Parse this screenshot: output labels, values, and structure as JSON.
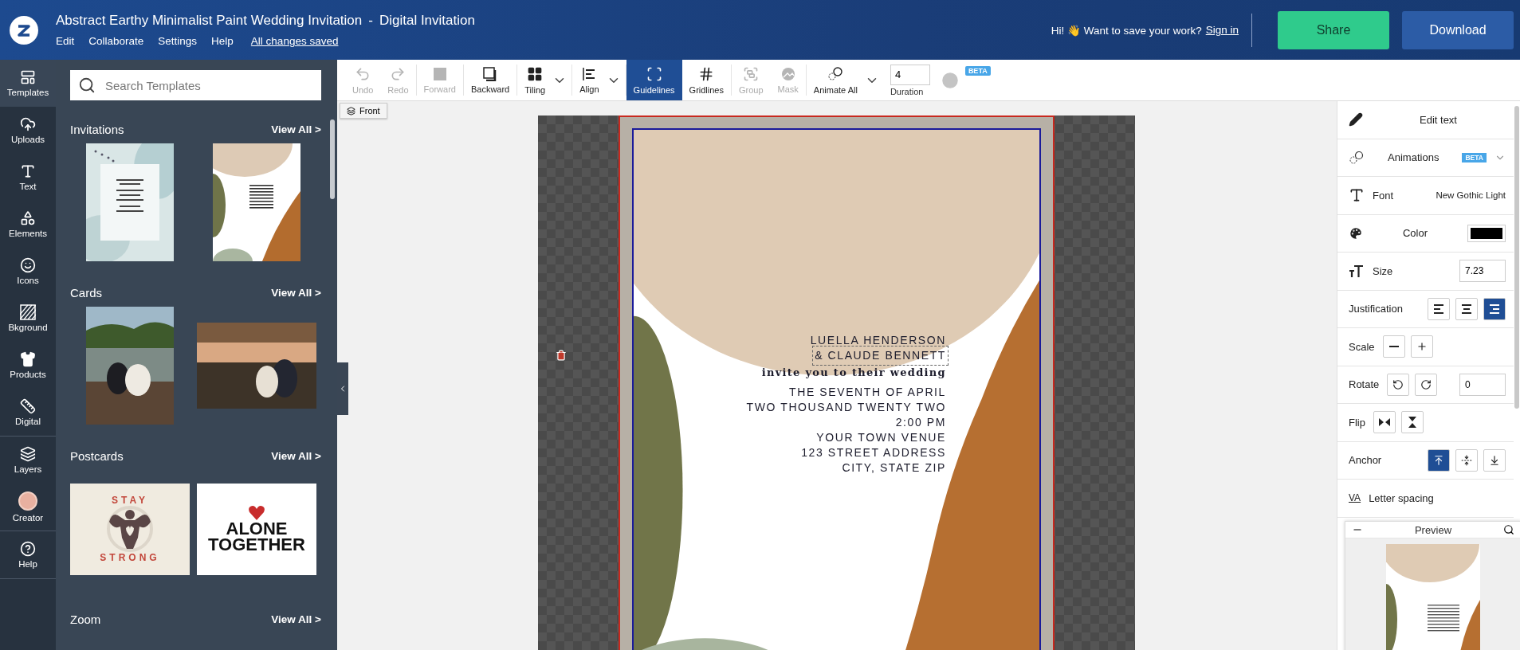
{
  "header": {
    "title": "Abstract Earthy Minimalist Paint Wedding Invitation",
    "separator": "-",
    "subtitle": "Digital Invitation",
    "menu": [
      "Edit",
      "Collaborate",
      "Settings",
      "Help"
    ],
    "save_status": "All changes saved",
    "greeting": "Hi! 👋 Want to save your work?",
    "sign_in": "Sign in",
    "buttons": [
      {
        "label": "Share",
        "kind": "share"
      },
      {
        "label": "Download",
        "kind": "download"
      }
    ]
  },
  "rail_groups": [
    [
      {
        "label": "Templates",
        "kind": "templates",
        "selected": true
      },
      {
        "label": "Uploads",
        "kind": "uploads",
        "selected": false
      },
      {
        "label": "Text",
        "kind": "text",
        "selected": false
      },
      {
        "label": "Elements",
        "kind": "elements",
        "selected": false
      },
      {
        "label": "Icons",
        "kind": "icons",
        "selected": false
      },
      {
        "label": "Bkground",
        "kind": "background",
        "selected": false
      },
      {
        "label": "Products",
        "kind": "products",
        "selected": false
      },
      {
        "label": "Digital",
        "kind": "digital",
        "selected": false
      }
    ],
    [
      {
        "label": "Layers",
        "kind": "layers",
        "selected": false
      },
      {
        "label": "Creator",
        "kind": "creator",
        "selected": false
      }
    ],
    [
      {
        "label": "Help",
        "kind": "help",
        "selected": false
      }
    ]
  ],
  "panel": {
    "search_placeholder": "Search Templates",
    "sections": [
      {
        "title": "Invitations",
        "view_all": "View All >",
        "items": [
          {
            "kind": "watercolor"
          },
          {
            "kind": "earthy"
          }
        ]
      },
      {
        "title": "Cards",
        "view_all": "View All >",
        "items": [
          {
            "kind": "portrait-picture"
          },
          {
            "kind": "landscape-picture"
          }
        ]
      },
      {
        "title": "Postcards",
        "view_all": "View All >",
        "items": [
          {
            "kind": "stay-strong",
            "lines": [
              "STAY",
              "STRONG"
            ]
          },
          {
            "kind": "alone-together",
            "lines": [
              "ALONE",
              "TOGETHER"
            ]
          }
        ]
      },
      {
        "title": "Zoom",
        "view_all": "View All >"
      }
    ]
  },
  "toolbar": {
    "tools": [
      {
        "label": "Undo",
        "kind": "undo",
        "disabled": true,
        "active": false,
        "dropdown": false
      },
      {
        "label": "Redo",
        "kind": "redo",
        "disabled": true,
        "active": false,
        "dropdown": false
      },
      {
        "label": "Forward",
        "kind": "forward",
        "disabled": true,
        "active": false,
        "dropdown": false
      },
      {
        "label": "Backward",
        "kind": "backward",
        "disabled": false,
        "active": false,
        "dropdown": false
      },
      {
        "label": "Tiling",
        "kind": "tiling",
        "disabled": false,
        "active": false,
        "dropdown": true
      },
      {
        "label": "Align",
        "kind": "align",
        "disabled": false,
        "active": false,
        "dropdown": true
      },
      {
        "label": "Guidelines",
        "kind": "guidelines",
        "disabled": false,
        "active": true,
        "dropdown": false
      },
      {
        "label": "Gridlines",
        "kind": "gridlines",
        "disabled": false,
        "active": false,
        "dropdown": false
      },
      {
        "label": "Group",
        "kind": "group",
        "disabled": true,
        "active": false,
        "dropdown": false
      },
      {
        "label": "Mask",
        "kind": "mask",
        "disabled": true,
        "active": false,
        "dropdown": false
      },
      {
        "label": "Animate All",
        "kind": "animate",
        "disabled": false,
        "active": false,
        "dropdown": true
      }
    ],
    "duration": {
      "value": "4",
      "label": "Duration"
    },
    "play_disabled": true,
    "badge": "BETA"
  },
  "layer_button": "Front",
  "design": {
    "lines": [
      {
        "text": "LUELLA HENDERSON",
        "kind": "sans",
        "selected": false
      },
      {
        "text": "& CLAUDE BENNETT",
        "kind": "sans",
        "selected": true
      },
      {
        "text": "invite you to their wedding",
        "kind": "serif",
        "selected": false
      },
      {
        "text": "THE SEVENTH OF APRIL",
        "kind": "sans",
        "selected": false
      },
      {
        "text": "TWO THOUSAND TWENTY TWO",
        "kind": "sans",
        "selected": false
      },
      {
        "text": "2:00 PM",
        "kind": "sans",
        "selected": false
      },
      {
        "text": "YOUR TOWN VENUE",
        "kind": "sans",
        "selected": false
      },
      {
        "text": "123 STREET ADDRESS",
        "kind": "sans",
        "selected": false
      },
      {
        "text": "CITY, STATE ZIP",
        "kind": "sans",
        "selected": false
      }
    ]
  },
  "properties": [
    {
      "kind": "edit",
      "label": "Edit text"
    },
    {
      "kind": "animations",
      "label": "Animations",
      "badge": "BETA"
    },
    {
      "kind": "font",
      "label": "Font",
      "value": "New Gothic Light"
    },
    {
      "kind": "color",
      "label": "Color",
      "color": "#000000"
    },
    {
      "kind": "size",
      "label": "Size",
      "value": "7.23"
    },
    {
      "kind": "justification",
      "label": "Justification",
      "options": [
        {
          "selected": false
        },
        {
          "selected": false
        },
        {
          "selected": true
        }
      ]
    },
    {
      "kind": "scale",
      "label": "Scale"
    },
    {
      "kind": "rotate",
      "label": "Rotate",
      "value": "0"
    },
    {
      "kind": "flip",
      "label": "Flip"
    },
    {
      "kind": "anchor",
      "label": "Anchor",
      "options": [
        {
          "selected": true
        },
        {
          "selected": false
        },
        {
          "selected": false
        }
      ]
    },
    {
      "kind": "spacing",
      "label": "Letter spacing",
      "icon_text": "VA"
    }
  ],
  "preview": {
    "title": "Preview"
  }
}
